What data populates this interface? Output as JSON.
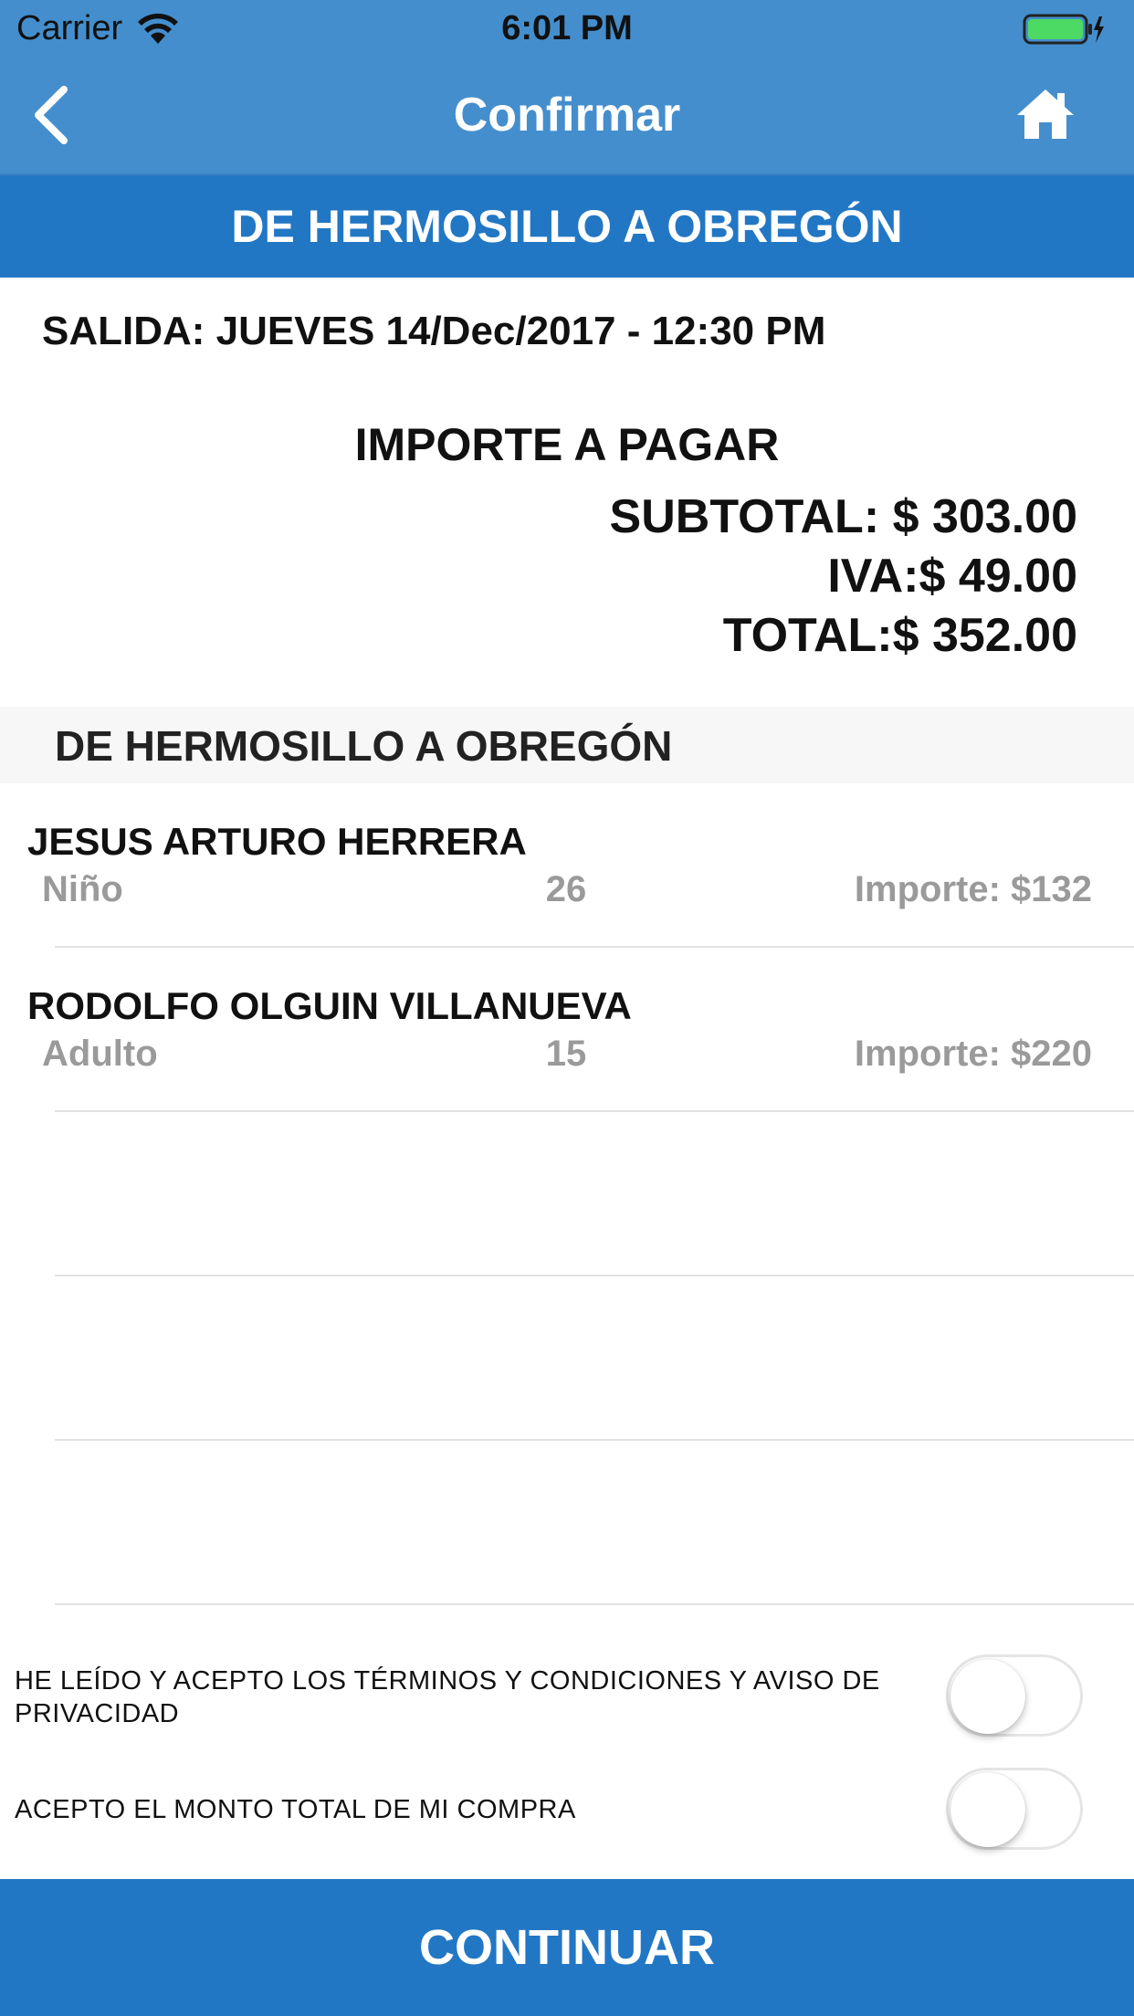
{
  "status_bar": {
    "carrier": "Carrier",
    "time": "6:01 PM",
    "icons": [
      "wifi-icon",
      "battery-icon",
      "charging-bolt-icon"
    ]
  },
  "nav": {
    "title": "Confirmar",
    "back_icon": "chevron-left-icon",
    "home_icon": "home-icon"
  },
  "route_banner": "DE HERMOSILLO A OBREGÓN",
  "salida": "SALIDA: JUEVES 14/Dec/2017 - 12:30 PM",
  "importe": {
    "title": "IMPORTE A PAGAR",
    "subtotal": "SUBTOTAL: $ 303.00",
    "iva": "IVA:$ 49.00",
    "total": "TOTAL:$ 352.00"
  },
  "section_header": "DE HERMOSILLO A OBREGÓN",
  "passengers": [
    {
      "name": "JESUS ARTURO HERRERA",
      "type": "Niño",
      "seat": "26",
      "importe": "Importe: $132"
    },
    {
      "name": "RODOLFO OLGUIN VILLANUEVA",
      "type": "Adulto",
      "seat": "15",
      "importe": "Importe: $220"
    }
  ],
  "terms": {
    "privacy_text": "HE LEÍDO Y ACEPTO LOS TÉRMINOS Y CONDICIONES Y AVISO DE PRIVACIDAD",
    "privacy_accepted": false,
    "amount_text": "ACEPTO EL MONTO TOTAL DE MI COMPRA",
    "amount_accepted": false
  },
  "continue_label": "CONTINUAR",
  "colors": {
    "nav_blue": "#448ecd",
    "banner_blue": "#2277c4",
    "muted_text": "#9a9a9a"
  }
}
